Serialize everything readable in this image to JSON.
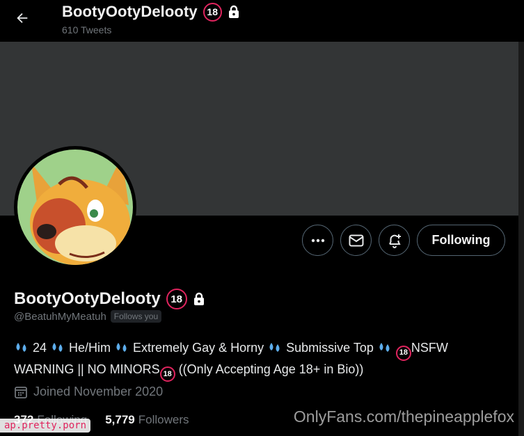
{
  "header": {
    "title": "BootyOotyDelooty",
    "age_badge": "18",
    "tweet_count": "610 Tweets"
  },
  "profile": {
    "name": "BootyOotyDelooty",
    "age_badge": "18",
    "handle": "@BeatuhMyMeatuh",
    "follows_you": "Follows you",
    "bio": {
      "t1": " 24 ",
      "t2": " He/Him ",
      "t3": " Extremely Gay & Horny ",
      "t4": " Submissive Top ",
      "t5": "NSFW WARNING || NO MINORS",
      "t6": " ((Only Accepting Age 18+ in Bio))",
      "badge": "18"
    },
    "joined": "Joined November 2020",
    "following_count": "372",
    "following_label": "Following",
    "followers_count": "5,779",
    "followers_label": "Followers"
  },
  "actions": {
    "following_label": "Following"
  },
  "icons": {
    "back": "arrow-left-icon",
    "lock": "lock-icon",
    "more": "more-dots-icon",
    "message": "envelope-icon",
    "notify": "bell-plus-icon",
    "calendar": "calendar-icon",
    "droplets": "sweat-droplets-icon"
  },
  "colors": {
    "background": "#000000",
    "banner": "#333536",
    "age_badge_ring": "#e0245e",
    "muted_text": "#71767b"
  },
  "watermarks": {
    "left": "ap.pretty.porn",
    "right": "OnlyFans.com/thepineapplefox"
  }
}
